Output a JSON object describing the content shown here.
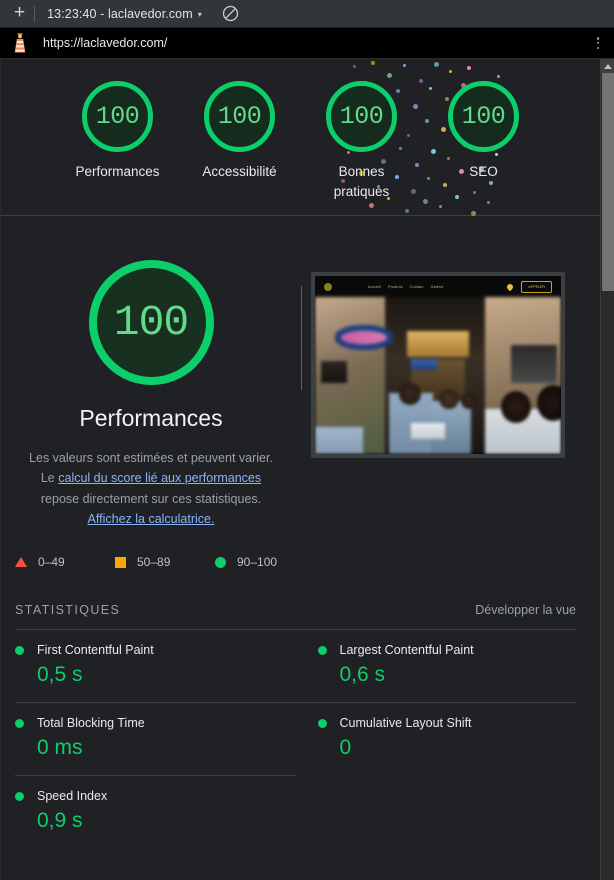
{
  "browser": {
    "new_tab_label": "+",
    "tab_title": "13:23:40 - laclavedor.com",
    "tab_caret": "▾",
    "block_icon": "block-icon",
    "url": "https://laclavedor.com/",
    "site_icon": "lighthouse-icon",
    "menu_icon": "kebab-menu-icon"
  },
  "gauges": [
    {
      "score": "100",
      "label": "Performances",
      "color": "#0cce6b"
    },
    {
      "score": "100",
      "label": "Accessibilité",
      "color": "#0cce6b"
    },
    {
      "score": "100",
      "label": "Bonnes pratiques",
      "color": "#0cce6b"
    },
    {
      "score": "100",
      "label": "SEO",
      "color": "#0cce6b"
    }
  ],
  "category": {
    "score": "100",
    "title": "Performances",
    "description_part1": "Les valeurs sont estimées et peuvent varier. Le ",
    "link1": "calcul du score lié aux performances",
    "description_part2": " repose directement sur ces statistiques. ",
    "link2": "Affichez la calculatrice.",
    "score_color": "#0cce6b"
  },
  "thumbnail": {
    "name": "page-screenshot-thumbnail",
    "nav_links": [
      "Accueil",
      "Produits",
      "Contact",
      "Galerie"
    ],
    "cta_label": "APPELER"
  },
  "legend": [
    {
      "shape": "triangle",
      "range": "0–49",
      "color": "#ff4e42"
    },
    {
      "shape": "square",
      "range": "50–89",
      "color": "#ffa400"
    },
    {
      "shape": "circle",
      "range": "90–100",
      "color": "#0cce6b"
    }
  ],
  "stats": {
    "title": "STATISTIQUES",
    "expand_label": "Développer la vue",
    "metrics": [
      {
        "name": "First Contentful Paint",
        "value": "0,5 s",
        "status_color": "#0cce6b"
      },
      {
        "name": "Largest Contentful Paint",
        "value": "0,6 s",
        "status_color": "#0cce6b"
      },
      {
        "name": "Total Blocking Time",
        "value": "0 ms",
        "status_color": "#0cce6b"
      },
      {
        "name": "Cumulative Layout Shift",
        "value": "0",
        "status_color": "#0cce6b"
      },
      {
        "name": "Speed Index",
        "value": "0,9 s",
        "status_color": "#0cce6b"
      }
    ]
  },
  "confetti_colors": [
    "#f28b82",
    "#fbbc04",
    "#81c995",
    "#8ab4f8",
    "#c58af9",
    "#78d9ec",
    "#fdd663",
    "#ff8bcb",
    "#aecbfa",
    "#ceead6"
  ]
}
